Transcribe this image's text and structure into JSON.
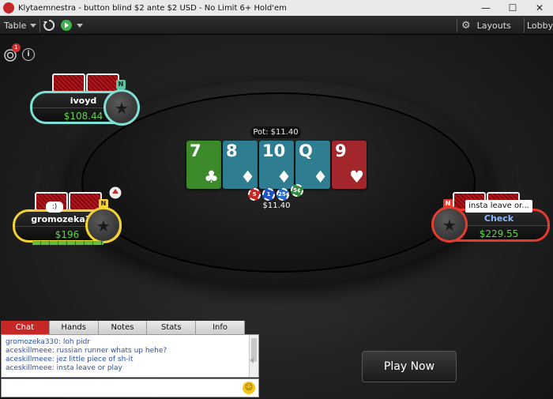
{
  "window": {
    "title": "Klytaemnestra - button blind $2 ante $2 USD - No Limit 6+ Hold'em",
    "minimize": "—",
    "maximize": "☐",
    "close": "✕"
  },
  "toolbar": {
    "table_label": "Table",
    "layouts_label": "Layouts",
    "lobby_label": "Lobby"
  },
  "notifications": {
    "badge_count": "1"
  },
  "pot": {
    "label": "Pot: $11.40",
    "total": "$11.40"
  },
  "board": [
    {
      "rank": "7",
      "suit": "♣",
      "color": "#3d8a2a"
    },
    {
      "rank": "8",
      "suit": "♦",
      "color": "#2e7d91"
    },
    {
      "rank": "10",
      "suit": "♦",
      "color": "#2e7d91"
    },
    {
      "rank": "Q",
      "suit": "♦",
      "color": "#2e7d91"
    },
    {
      "rank": "9",
      "suit": "♥",
      "color": "#a3262c"
    }
  ],
  "chips": [
    {
      "label": "5",
      "color": "#c62828"
    },
    {
      "label": "1",
      "color": "#1e50c8"
    },
    {
      "label": "25¢",
      "color": "#2a6ac0"
    },
    {
      "label": "5¢",
      "color": "#2f8f3a"
    }
  ],
  "players": {
    "top_left": {
      "name": "ivoyd",
      "stack": "$108.44",
      "ring_color": "#7de0d4"
    },
    "left": {
      "name": "gromozeka330",
      "stack": "$196",
      "ring_color": "#f2d230",
      "bubble": ":)"
    },
    "right": {
      "action": "Check",
      "stack": "$229.55",
      "ring_color": "#e53b2e",
      "tooltip": "insta leave or..."
    }
  },
  "dealer_button_label": "N",
  "chat": {
    "tabs": [
      "Chat",
      "Hands",
      "Notes",
      "Stats",
      "Info"
    ],
    "active_tab": "Chat",
    "lines": [
      "gromozeka330: loh pidr",
      "aceskillmeee: russian runner whats up hehe?",
      "aceskillmeee: jez little piece of sh-it",
      "aceskillmeee: insta leave or play"
    ]
  },
  "play_now_label": "Play Now"
}
